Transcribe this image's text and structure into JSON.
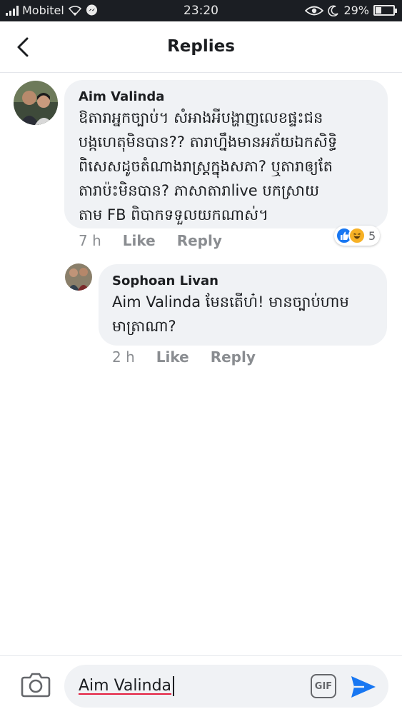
{
  "status_bar": {
    "carrier": "Mobitel",
    "time": "23:20",
    "battery": "29%",
    "battery_level": 0.29
  },
  "header": {
    "title": "Replies",
    "back_icon": "chevron-left-icon"
  },
  "comments": [
    {
      "author": "Aim Valinda",
      "lines": [
        "ឱតារាអ្នកច្បាប់។ សំអាងអីបង្ហាញលេខផ្ទះជន",
        "បង្កហេតុមិនបាន?? តារាហ្នឹងមានអភ័យឯកសិទ្ធិ",
        "ពិសេសដូចតំណាងរាស្ត្រក្នុងសភា? ឬតារាឲ្យតែ",
        "តារាប៉ះមិនបាន? ភាសាតារាlive បកស្រាយ",
        "តាម FB ពិបាកទទួលយកណាស់។"
      ],
      "time": "7 h",
      "like_label": "Like",
      "reply_label": "Reply",
      "reaction_count": "5"
    },
    {
      "author": "Sophoan Livan",
      "lines": [
        "Aim Valinda មែនតើហ៎! មានច្បាប់ហាម",
        "មាត្រាណា?"
      ],
      "time": "2 h",
      "like_label": "Like",
      "reply_label": "Reply"
    }
  ],
  "composer": {
    "input_value": "Aim Valinda",
    "gif_label": "GIF"
  },
  "colors": {
    "accent": "#1877f2",
    "bubble": "#f0f2f5",
    "status_bar": "#1b1e23"
  }
}
